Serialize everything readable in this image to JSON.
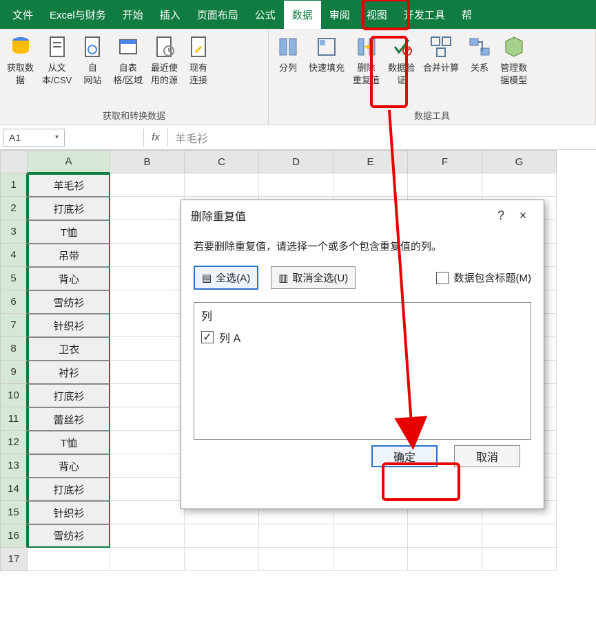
{
  "menu": {
    "file": "文件",
    "excel_finance": "Excel与财务",
    "home": "开始",
    "insert": "插入",
    "page_layout": "页面布局",
    "formulas": "公式",
    "data": "数据",
    "review": "审阅",
    "view": "视图",
    "developer": "开发工具",
    "help": "帮"
  },
  "ribbon": {
    "group1_label": "获取和转换数据",
    "group2_label": "数据工具",
    "btn_get_data": "获取数\n据",
    "btn_from_text": "从文\n本/CSV",
    "btn_from_web": "自\n网站",
    "btn_from_table": "自表\n格/区域",
    "btn_recent": "最近使\n用的源",
    "btn_existing": "现有\n连接",
    "btn_split": "分列",
    "btn_flashfill": "快速填充",
    "btn_remove_dup": "删除\n重复值",
    "btn_data_valid": "数据验\n证",
    "btn_consolidate": "合并计算",
    "btn_relations": "关系",
    "btn_data_model": "管理数\n据模型"
  },
  "namebox": "A1",
  "formula": "羊毛衫",
  "fx_label": "fx",
  "columns": [
    "A",
    "B",
    "C",
    "D",
    "E",
    "F",
    "G"
  ],
  "rows_count": 17,
  "column_a": [
    "羊毛衫",
    "打底衫",
    "T恤",
    "吊带",
    "背心",
    "雪纺衫",
    "针织衫",
    "卫衣",
    "衬衫",
    "打底衫",
    "蕾丝衫",
    "T恤",
    "背心",
    "打底衫",
    "针织衫",
    "雪纺衫"
  ],
  "dialog": {
    "title": "删除重复值",
    "help_char": "?",
    "close_char": "×",
    "instruction": "若要删除重复值，请选择一个或多个包含重复值的列。",
    "select_all": "全选(A)",
    "unselect_all": "取消全选(U)",
    "data_has_header": "数据包含标题(M)",
    "list_header": "列",
    "list_item": "列 A",
    "ok": "确定",
    "cancel": "取消"
  },
  "icons": {
    "select_all_glyph": "▤",
    "unselect_glyph": "▥",
    "check_mark": "✓"
  }
}
